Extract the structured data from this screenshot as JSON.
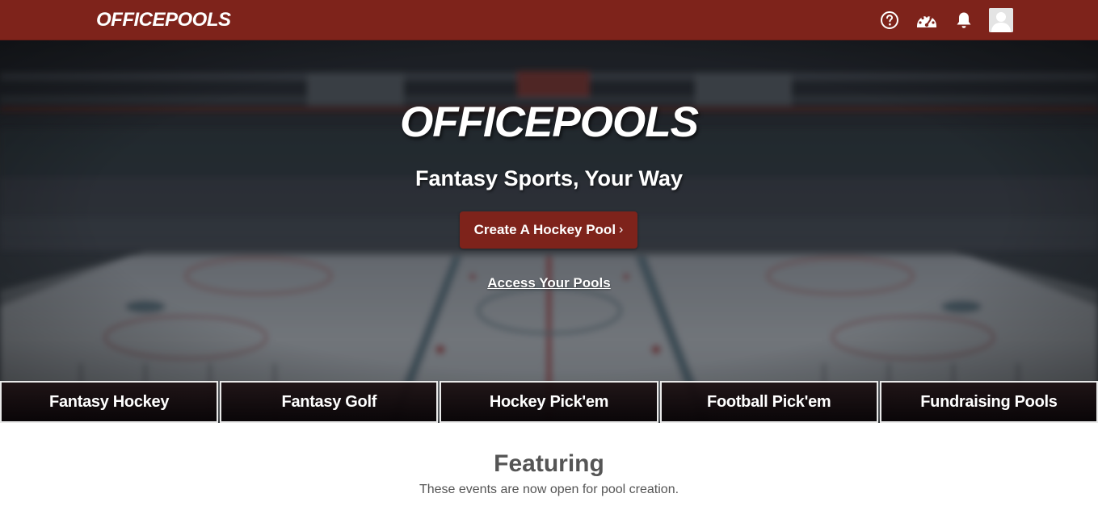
{
  "header": {
    "brand": "OFFICEPOOLS",
    "icons": [
      "help-icon",
      "dashboard-icon",
      "notification-bell-icon",
      "user-avatar"
    ]
  },
  "hero": {
    "title": "OFFICEPOOLS",
    "subtitle": "Fantasy Sports, Your Way",
    "cta_label": "Create A Hockey Pool",
    "cta_arrow": "›",
    "access_link": "Access Your Pools"
  },
  "categories": [
    {
      "label": "Fantasy Hockey"
    },
    {
      "label": "Fantasy Golf"
    },
    {
      "label": "Hockey Pick'em"
    },
    {
      "label": "Football Pick'em"
    },
    {
      "label": "Fundraising Pools"
    }
  ],
  "featuring": {
    "title": "Featuring",
    "subtitle": "These events are now open for pool creation."
  },
  "colors": {
    "brand": "#7e231b",
    "text_muted": "#555555",
    "white": "#ffffff"
  }
}
